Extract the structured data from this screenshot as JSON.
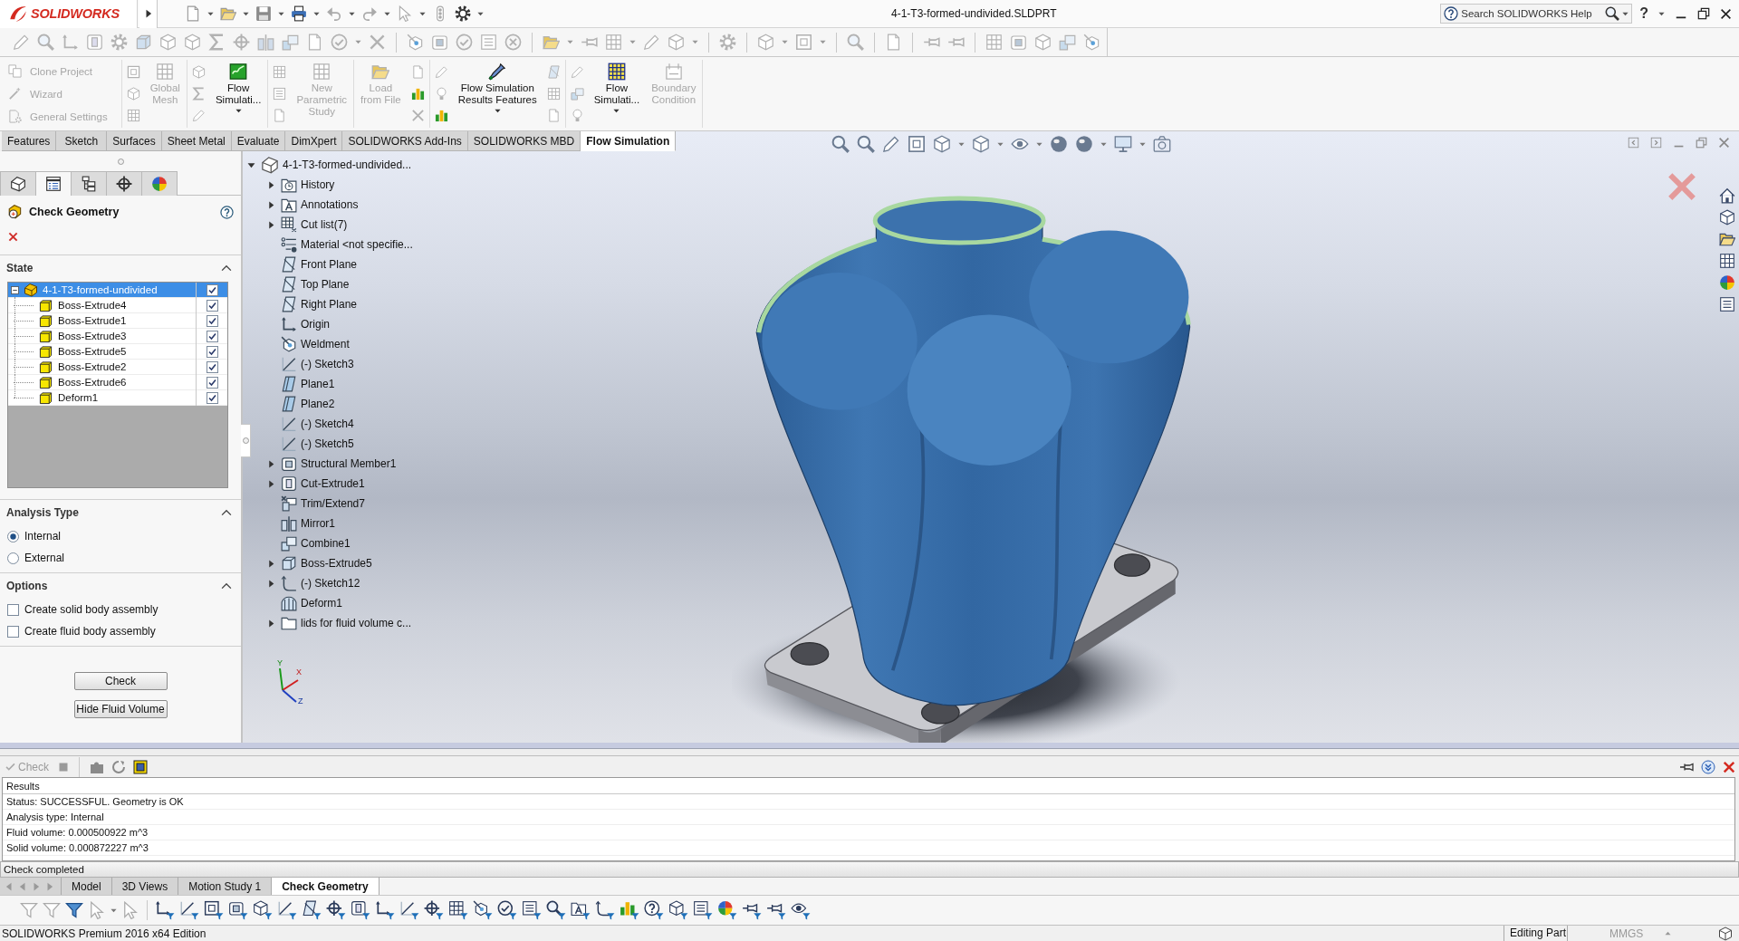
{
  "title_bar": {
    "logo": "SOLIDWORKS",
    "document_title": "4-1-T3-formed-undivided.SLDPRT",
    "search": {
      "placeholder": "Search SOLIDWORKS Help"
    },
    "help_button": "?"
  },
  "command_manager": {
    "groups": [
      {
        "items": [
          {
            "kind": "row",
            "label": "Clone Project",
            "disabled": true
          },
          {
            "kind": "row",
            "label": "Wizard",
            "disabled": true
          },
          {
            "kind": "row",
            "label": "General Settings",
            "disabled": true
          }
        ]
      },
      {
        "items": [
          {
            "kind": "icons"
          },
          {
            "kind": "large",
            "label": "Global\nMesh",
            "disabled": true,
            "dropdown": false
          }
        ]
      },
      {
        "items": [
          {
            "kind": "icons"
          },
          {
            "kind": "large",
            "label": "Flow\nSimulati...",
            "disabled": false,
            "dropdown": true
          }
        ]
      },
      {
        "items": [
          {
            "kind": "icons"
          },
          {
            "kind": "large",
            "label": "New\nParametric\nStudy",
            "disabled": true,
            "dropdown": false
          }
        ]
      },
      {
        "items": [
          {
            "kind": "large",
            "label": "Load\nfrom File",
            "disabled": true,
            "dropdown": false
          },
          {
            "kind": "icons"
          }
        ]
      },
      {
        "items": [
          {
            "kind": "icons"
          },
          {
            "kind": "large",
            "label": "Flow Simulation\nResults Features",
            "disabled": false,
            "dropdown": true
          },
          {
            "kind": "icons"
          }
        ]
      },
      {
        "items": [
          {
            "kind": "icons"
          },
          {
            "kind": "large",
            "label": "Flow\nSimulati...",
            "disabled": false,
            "dropdown": true
          },
          {
            "kind": "large",
            "label": "Boundary\nCondition",
            "disabled": true,
            "dropdown": false
          }
        ]
      }
    ]
  },
  "tabs": [
    {
      "label": "Features",
      "selected": false
    },
    {
      "label": "Sketch",
      "selected": false
    },
    {
      "label": "Surfaces",
      "selected": false
    },
    {
      "label": "Sheet Metal",
      "selected": false
    },
    {
      "label": "Evaluate",
      "selected": false
    },
    {
      "label": "DimXpert",
      "selected": false
    },
    {
      "label": "SOLIDWORKS Add-Ins",
      "selected": false
    },
    {
      "label": "SOLIDWORKS MBD",
      "selected": false
    },
    {
      "label": "Flow Simulation",
      "selected": true
    }
  ],
  "property_manager": {
    "tabs": [
      {
        "selected": false
      },
      {
        "selected": true
      },
      {
        "selected": false
      },
      {
        "selected": false
      },
      {
        "selected": false
      }
    ],
    "title": "Check Geometry",
    "sections": [
      {
        "kind": "tree",
        "title": "State",
        "expanded": true,
        "tree": {
          "label": "4-1-T3-formed-undivided",
          "selected": true,
          "expanded": true,
          "checked": true,
          "children": [
            {
              "label": "Boss-Extrude4",
              "selected": false,
              "checked": true
            },
            {
              "label": "Boss-Extrude1",
              "selected": false,
              "checked": true
            },
            {
              "label": "Boss-Extrude3",
              "selected": false,
              "checked": true
            },
            {
              "label": "Boss-Extrude5",
              "selected": false,
              "checked": true
            },
            {
              "label": "Boss-Extrude2",
              "selected": false,
              "checked": true
            },
            {
              "label": "Boss-Extrude6",
              "selected": false,
              "checked": true
            },
            {
              "label": "Deform1",
              "selected": false,
              "checked": true
            }
          ]
        }
      },
      {
        "kind": "radio",
        "title": "Analysis Type",
        "expanded": true,
        "options": [
          {
            "label": "Internal",
            "selected": true
          },
          {
            "label": "External",
            "selected": false
          }
        ]
      },
      {
        "kind": "checkbox",
        "title": "Options",
        "expanded": true,
        "options": [
          {
            "label": "Create solid body assembly",
            "checked": false
          },
          {
            "label": "Create fluid body assembly",
            "checked": false
          }
        ]
      }
    ],
    "buttons": [
      "Check",
      "Hide Fluid Volume"
    ]
  },
  "feature_tree": {
    "root": {
      "label": "4-1-T3-formed-undivided...",
      "expanded": true,
      "children": [
        {
          "label": "History",
          "kind": "history",
          "expandable": true
        },
        {
          "label": "Annotations",
          "kind": "annotations",
          "expandable": true
        },
        {
          "label": "Cut list(7)",
          "kind": "cutlist",
          "expandable": true
        },
        {
          "label": "Material <not specifie...",
          "kind": "material",
          "expandable": false
        },
        {
          "label": "Front Plane",
          "kind": "plane",
          "expandable": false
        },
        {
          "label": "Top Plane",
          "kind": "plane",
          "expandable": false
        },
        {
          "label": "Right Plane",
          "kind": "plane",
          "expandable": false
        },
        {
          "label": "Origin",
          "kind": "origin",
          "expandable": false
        },
        {
          "label": "Weldment",
          "kind": "weldment",
          "expandable": false
        },
        {
          "label": "(-) Sketch3",
          "kind": "sketch",
          "expandable": false
        },
        {
          "label": "Plane1",
          "kind": "refplane",
          "expandable": false
        },
        {
          "label": "Plane2",
          "kind": "refplane",
          "expandable": false
        },
        {
          "label": "(-) Sketch4",
          "kind": "sketch",
          "expandable": false
        },
        {
          "label": "(-) Sketch5",
          "kind": "sketch",
          "expandable": false
        },
        {
          "label": "Structural Member1",
          "kind": "structural",
          "expandable": true
        },
        {
          "label": "Cut-Extrude1",
          "kind": "cut",
          "expandable": true
        },
        {
          "label": "Trim/Extend7",
          "kind": "trim",
          "expandable": false
        },
        {
          "label": "Mirror1",
          "kind": "mirror",
          "expandable": false
        },
        {
          "label": "Combine1",
          "kind": "combine",
          "expandable": false
        },
        {
          "label": "Boss-Extrude5",
          "kind": "boss",
          "expandable": true
        },
        {
          "label": "(-) Sketch12",
          "kind": "sketch3d",
          "expandable": true
        },
        {
          "label": "Deform1",
          "kind": "deform",
          "expandable": false
        },
        {
          "label": "lids for fluid volume c...",
          "kind": "folder",
          "expandable": true
        }
      ]
    }
  },
  "view_triad": {
    "y_label": "Y",
    "x_label": "X",
    "z_label": "Z"
  },
  "output_panel": {
    "check_button": {
      "label": "Check",
      "disabled": true
    },
    "results": {
      "header": "Results",
      "rows": [
        "Status: SUCCESSFUL. Geometry is OK",
        "Analysis type: Internal",
        "Fluid volume: 0.000500922 m^3",
        "Solid volume: 0.000872227 m^3"
      ]
    },
    "message": "Check completed"
  },
  "bottom_tabs": [
    {
      "label": "Model",
      "selected": false
    },
    {
      "label": "3D Views",
      "selected": false
    },
    {
      "label": "Motion Study 1",
      "selected": false
    },
    {
      "label": "Check Geometry",
      "selected": true
    }
  ],
  "status_bar": {
    "edition": "SOLIDWORKS Premium 2016 x64 Edition",
    "mode": "Editing Part",
    "units": "MMGS"
  }
}
